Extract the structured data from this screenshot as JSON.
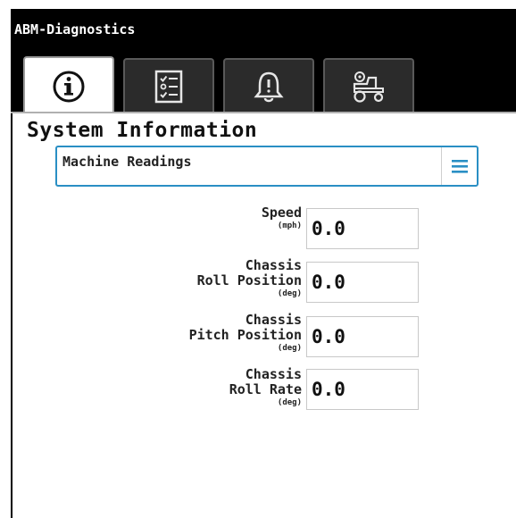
{
  "app": {
    "title": "ABM-Diagnostics"
  },
  "tabs": [
    {
      "icon": "info-icon",
      "active": true
    },
    {
      "icon": "checklist-icon",
      "active": false
    },
    {
      "icon": "bell-alert-icon",
      "active": false
    },
    {
      "icon": "tractor-settings-icon",
      "active": false
    }
  ],
  "page": {
    "title": "System Information"
  },
  "dropdown": {
    "selected": "Machine Readings",
    "icon": "hamburger-menu-icon"
  },
  "readings": [
    {
      "label_lines": [
        "Speed"
      ],
      "unit": "(mph)",
      "value": "0.0"
    },
    {
      "label_lines": [
        "Chassis",
        "Roll Position"
      ],
      "unit": "(deg)",
      "value": "0.0"
    },
    {
      "label_lines": [
        "Chassis",
        "Pitch Position"
      ],
      "unit": "(deg)",
      "value": "0.0"
    },
    {
      "label_lines": [
        "Chassis",
        "Roll Rate"
      ],
      "unit": "(deg)",
      "value": "0.0"
    }
  ],
  "colors": {
    "accent": "#2a8fc4",
    "titlebar": "#000000",
    "tab_inactive": "#2b2b2b"
  }
}
